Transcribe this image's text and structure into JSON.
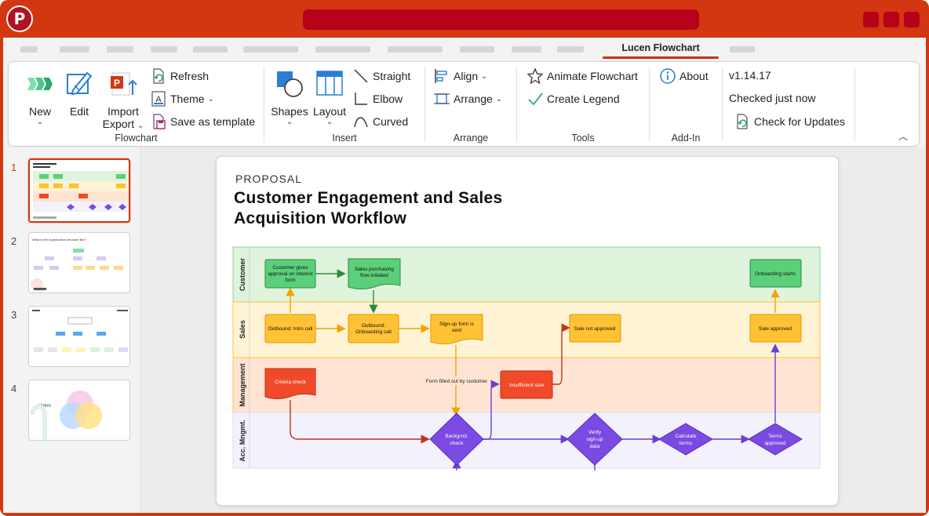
{
  "app": {
    "icon_letter": "P",
    "accent": "#d23711"
  },
  "ribbon": {
    "active_tab": "Lucen Flowchart",
    "groups": {
      "flowchart": {
        "label": "Flowchart",
        "new": "New",
        "edit": "Edit",
        "import": "Import",
        "export": "Export",
        "refresh": "Refresh",
        "theme": "Theme",
        "save_template": "Save as template"
      },
      "insert": {
        "label": "Insert",
        "shapes": "Shapes",
        "layout": "Layout",
        "straight": "Straight",
        "elbow": "Elbow",
        "curved": "Curved"
      },
      "arrange": {
        "label": "Arrange",
        "align": "Align",
        "arrange": "Arrange"
      },
      "tools": {
        "label": "Tools",
        "animate": "Animate Flowchart",
        "legend": "Create Legend"
      },
      "addin": {
        "label": "Add-In",
        "about": "About"
      },
      "version": {
        "version": "v1.14.17",
        "checked": "Checked just now",
        "check_updates": "Check for Updates"
      }
    }
  },
  "slides": {
    "numbers": [
      "1",
      "2",
      "3",
      "4"
    ],
    "thumb2_title": "What is the organization structure like?",
    "thumb4_title": "Hstrm"
  },
  "slide": {
    "kicker": "PROPOSAL",
    "title": "Customer Engagement and Sales Acquisition Workflow"
  },
  "diagram": {
    "lanes": [
      "Customer",
      "Sales",
      "Management",
      "Acc. Mngmt."
    ],
    "lane_colors": [
      "#dff3dd",
      "#fff3d6",
      "#ffe4d3",
      "#f3f1fb"
    ],
    "nodes": {
      "n1": "Customer gives approval on interest form",
      "n2": "Sales purchasing flow initiated",
      "n3": "Onboarding starts",
      "n4": "Outbound: Intro call",
      "n5": "Outbound: Onboarding call",
      "n6": "Sign-up form is sent",
      "n7": "Sale not approved",
      "n8": "Sale approved",
      "n9": "Criteria check",
      "n10": "Insufficient size",
      "n11": "Backgrnd. check",
      "n12": "Verify sign-up data",
      "n13": "Calculate terms",
      "n14": "Terms approved"
    },
    "edge_label": "Form filled out by customer"
  }
}
